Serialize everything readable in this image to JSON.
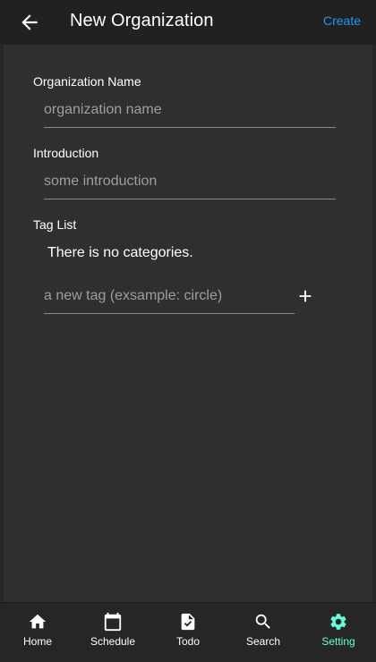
{
  "appbar": {
    "title": "New Organization",
    "create_label": "Create",
    "back_icon": "arrow-back-icon"
  },
  "form": {
    "org_name": {
      "label": "Organization Name",
      "placeholder": "organization name",
      "value": ""
    },
    "introduction": {
      "label": "Introduction",
      "placeholder": "some introduction",
      "value": ""
    },
    "tags": {
      "label": "Tag List",
      "empty_text": "There is no categories.",
      "new_tag_placeholder": "a new tag (exsample: circle)",
      "new_tag_value": "",
      "add_icon": "plus-icon"
    }
  },
  "nav": {
    "items": [
      {
        "label": "Home",
        "icon": "home-icon"
      },
      {
        "label": "Schedule",
        "icon": "calendar-icon"
      },
      {
        "label": "Todo",
        "icon": "task-icon"
      },
      {
        "label": "Search",
        "icon": "search-icon"
      },
      {
        "label": "Setting",
        "icon": "gear-icon"
      }
    ],
    "active": "Setting"
  },
  "colors": {
    "background": "#2f2f2f",
    "appbar": "#212121",
    "accent_link": "#2196f3",
    "active_nav": "#64ffda"
  }
}
